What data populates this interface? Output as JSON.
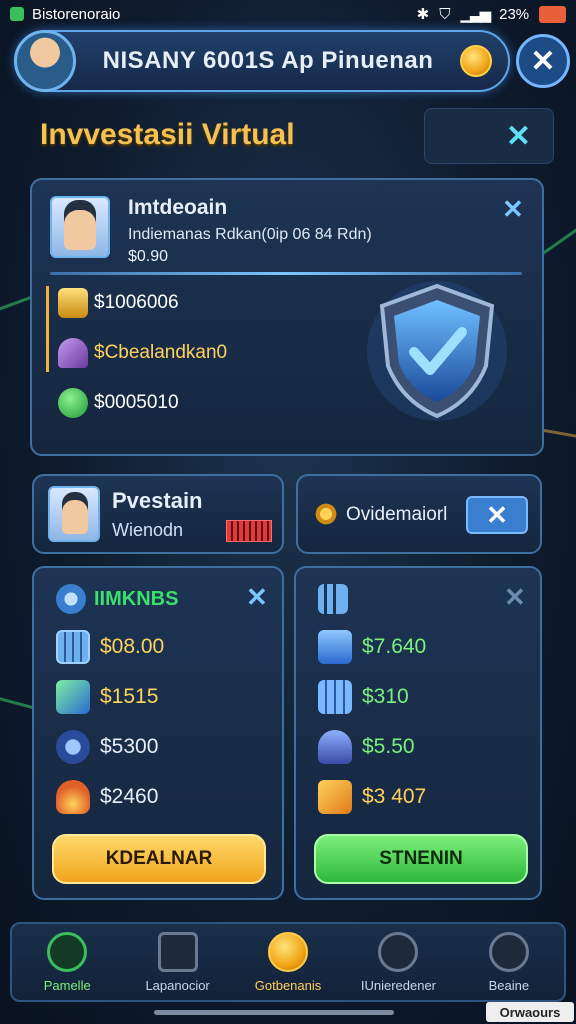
{
  "status_bar": {
    "left_text": "Bistorenoraio",
    "right_text": "23%"
  },
  "header": {
    "title": "NISANY 6001S Ap Pinuenan"
  },
  "page": {
    "title": "Invvestasii Virtual"
  },
  "profile": {
    "name": "Imtdeoain",
    "subtitle": "Indiemanas Rdkan(0ip 06 84 Rdn)",
    "balance": "$0.90",
    "stats": [
      {
        "icon": "gold-bars-icon",
        "value": "$1006006",
        "color": "#f0b43a"
      },
      {
        "icon": "gem-icon",
        "value": "$Cbealandkan0",
        "color": "#b07ad8"
      },
      {
        "icon": "green-coin-icon",
        "value": "$0005010",
        "color": "#3ac05a"
      }
    ]
  },
  "mid_left": {
    "title": "Pvestain",
    "subtitle": "Wienodn"
  },
  "mid_right": {
    "label": "Ovidemaiorl"
  },
  "card_left": {
    "header": "IIMKNBS",
    "rows": [
      {
        "icon": "calculator-icon",
        "value": "$08.00",
        "color": "#ffd25a"
      },
      {
        "icon": "chart-check-icon",
        "value": "$1515",
        "color": "#ffd25a"
      },
      {
        "icon": "clock-icon",
        "value": "$5300",
        "color": "#ffffff"
      },
      {
        "icon": "flame-icon",
        "value": "$2460",
        "color": "#ffffff"
      }
    ],
    "button": "KDEALNAR"
  },
  "card_right": {
    "rows": [
      {
        "icon": "stack-icon",
        "value": "$7.640",
        "color": "#7cf07c"
      },
      {
        "icon": "building-icon",
        "value": "$310",
        "color": "#7cf07c"
      },
      {
        "icon": "users-icon",
        "value": "$5.50",
        "color": "#7cf07c"
      },
      {
        "icon": "envelope-icon",
        "value": "$3 407",
        "color": "#ffd25a"
      }
    ],
    "button": "STNENIN"
  },
  "bottom_nav": [
    {
      "label": "Pamelle",
      "icon": "home-icon"
    },
    {
      "label": "Lapanocior",
      "icon": "star-badge-icon"
    },
    {
      "label": "Gotbenanis",
      "icon": "coin-icon"
    },
    {
      "label": "IUnieredener",
      "icon": "frame-icon"
    },
    {
      "label": "Beaine",
      "icon": "alert-icon"
    }
  ],
  "watermark": "Orwaours"
}
